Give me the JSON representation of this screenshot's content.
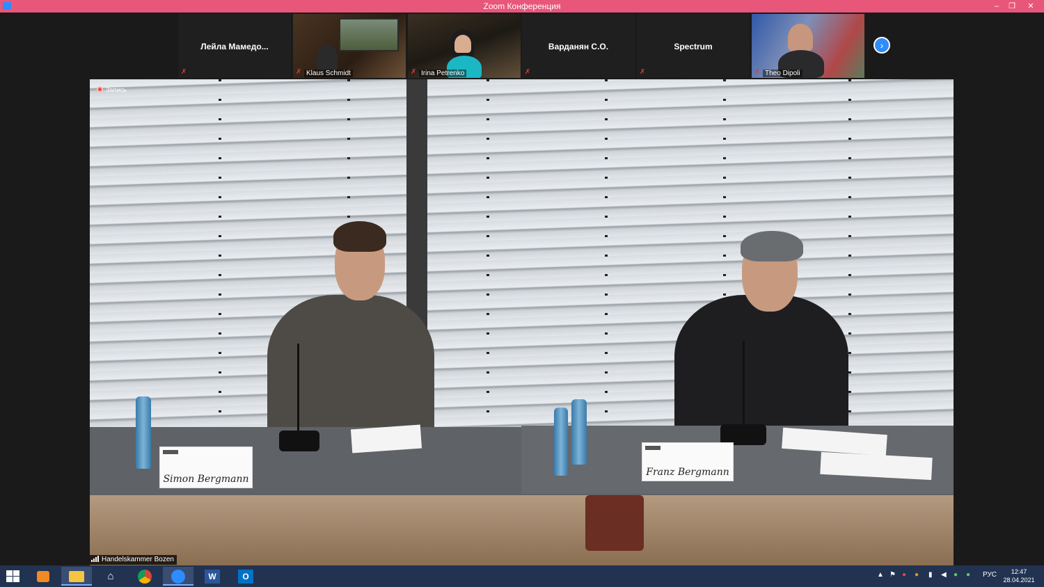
{
  "window": {
    "title": "Zoom Конференция",
    "minimize": "–",
    "maximize": "❐",
    "close": "✕"
  },
  "participants": [
    {
      "name": "Лейла  Мамедо...",
      "has_video": false
    },
    {
      "name": "Klaus Schmidt",
      "has_video": true
    },
    {
      "name": "Irina Petrenko",
      "has_video": true
    },
    {
      "name": "Варданян С.О.",
      "has_video": false
    },
    {
      "name": "Spectrum",
      "has_video": false
    },
    {
      "name": "Theo Dipoli",
      "has_video": true
    }
  ],
  "strip": {
    "next_icon": "chevron-right-icon",
    "next_glyph": "›"
  },
  "main": {
    "recording_label": "Запись",
    "speaker": "Handelskammer Bozen",
    "nameplates": [
      "Simon Bergmann",
      "Franz Bergmann"
    ]
  },
  "taskbar": {
    "apps": [
      "start",
      "media-player",
      "file-explorer",
      "home",
      "chrome",
      "zoom",
      "word",
      "outlook"
    ],
    "language": "РУС",
    "time": "12:47",
    "date": "28.04.2021"
  },
  "colors": {
    "titlebar": "#e8567a",
    "zoom_blue": "#2d8cff",
    "taskbar": "#223251"
  }
}
